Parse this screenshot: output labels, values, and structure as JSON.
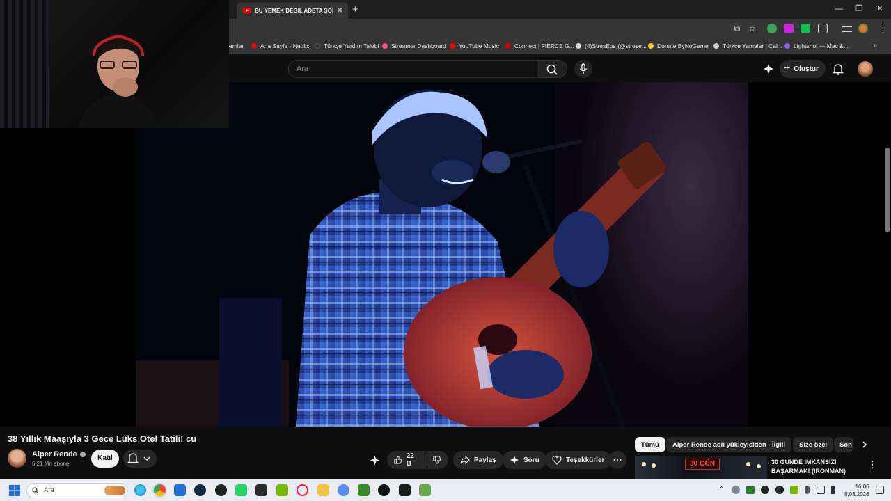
{
  "browser": {
    "tab": {
      "title": "BU YEMEK DEĞİL ADETA ŞÖLEN"
    },
    "bookmarks": [
      {
        "label": "emler",
        "color": "#777777"
      },
      {
        "label": "Ana Sayfa - Netflix",
        "color": "#e50914"
      },
      {
        "label": "Türkçe Yardım Talebi",
        "color": "#333333"
      },
      {
        "label": "Streamer Dashboard",
        "color": "#ff4d8d"
      },
      {
        "label": "YouTube Music",
        "color": "#ff0000"
      },
      {
        "label": "Connect | FIERCE G...",
        "color": "#cc0000"
      },
      {
        "label": "(4)StresEos (@strese...",
        "color": "#dddddd"
      },
      {
        "label": "Donate ByNoGame",
        "color": "#f2c230"
      },
      {
        "label": "Türkçe Yamalar | Cal...",
        "color": "#cfcfcf"
      },
      {
        "label": "Lightshot — Mac &...",
        "color": "#9b59ff"
      }
    ]
  },
  "youtube": {
    "search_placeholder": "Ara",
    "create_label": "Oluştur"
  },
  "video": {
    "title": "38 Yıllık Maaşıyla 3 Gece Lüks Otel Tatili! cu",
    "channel_name": "Alper Rende",
    "subscribers": "6,21 Mn abone",
    "join_label": "Katıl",
    "like_count": "22 B",
    "share_label": "Paylaş",
    "ask_label": "Soru",
    "thanks_label": "Teşekkürler"
  },
  "sidebar": {
    "chips": [
      "Tümü",
      "Alper Rende adlı yükleyiciden",
      "İlgili",
      "Size özel",
      "Son"
    ],
    "recommendation": {
      "thumb_text": "30 GÜN",
      "title_line1": "30 GÜNDE İMKANSIZI",
      "title_line2": "BAŞARMAK! (IRONMAN)"
    }
  },
  "taskbar": {
    "search_placeholder": "Ara",
    "time": "16:06",
    "date": "8.08.2026"
  }
}
